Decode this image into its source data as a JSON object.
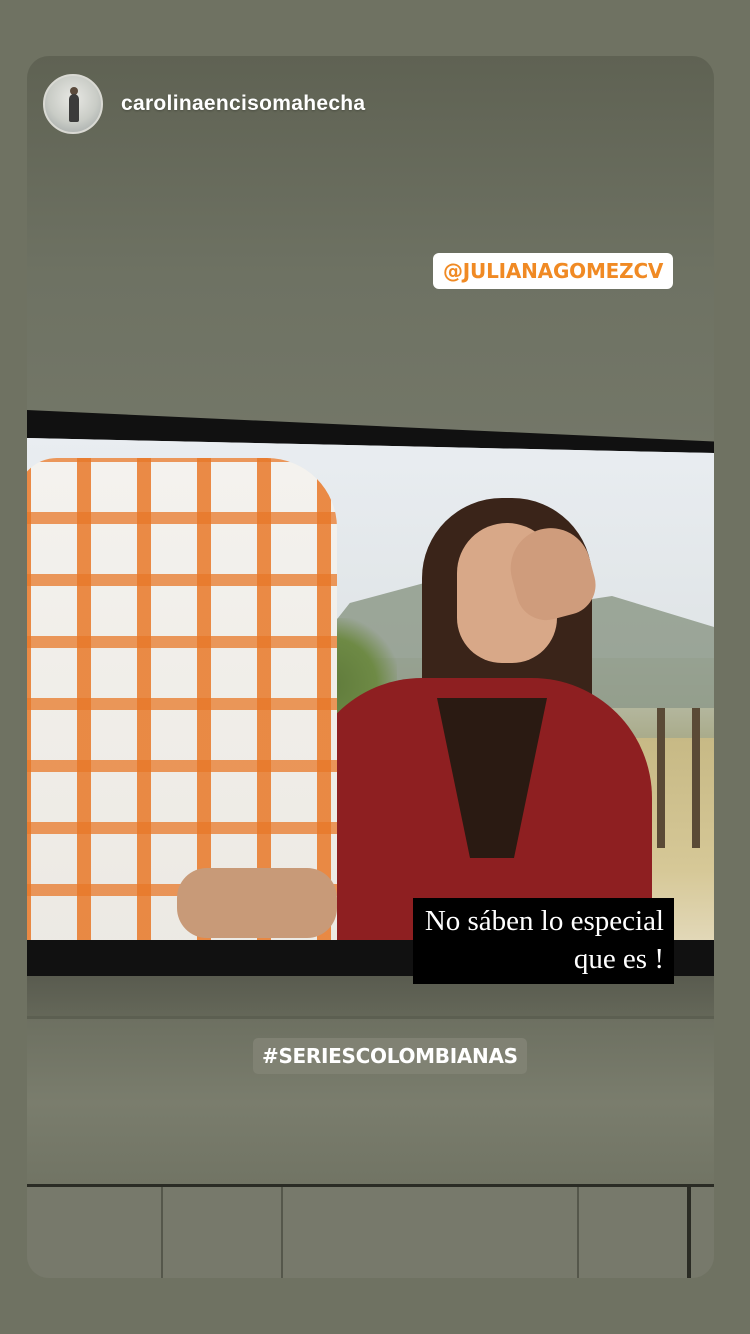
{
  "story": {
    "username": "carolinaencisomahecha",
    "avatar_icon": "profile-photo-icon"
  },
  "stickers": {
    "mention": "@JULIANAGOMEZCV",
    "hashtag": "#SERIESCOLOMBIANAS"
  },
  "subtitle": {
    "line1": "No sáben lo especial",
    "line2": "que es !"
  },
  "colors": {
    "mention_text": "#f08a24",
    "background": "#6f7262"
  }
}
